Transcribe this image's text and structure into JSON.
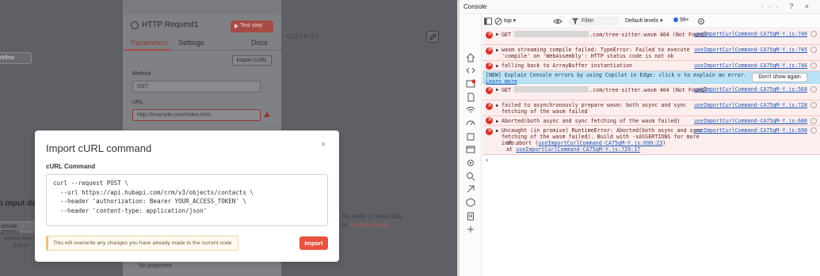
{
  "background": {
    "workflow_select": "rkflow",
    "no_input": "o input da",
    "execute_previous": "xecute previou",
    "hint_left": "earliest node t... data ye",
    "output_label": "OUTPUT",
    "hint_right_1": "his node to view data",
    "hint_right_2_prefix": "or ",
    "hint_right_2_link": "set mock data",
    "pencil_icon": "pencil-icon"
  },
  "node": {
    "title": "HTTP Request1",
    "test_step": "Test step",
    "tabs": [
      "Parameters",
      "Settings",
      "Docs"
    ],
    "import_curl": "Import cURL",
    "method_label": "Method",
    "method_value": "GET",
    "url_label": "URL",
    "url_placeholder": "http://example.com/index.html",
    "no_properties": "No properties"
  },
  "modal": {
    "title": "Import cURL command",
    "close_label": "×",
    "curl_label": "cURL Command",
    "curl_value": "curl --request POST \\\n  --url https://api.hubapi.com/crm/v3/objects/contacts \\\n  --header 'authorization: Bearer YOUR_ACCESS_TOKEN' \\\n  --header 'content-type: application/json'",
    "warning": "This will overwrite any changes you have already made to the current node",
    "import_button": "Import"
  },
  "devtools": {
    "title": "Console",
    "title_controls": "··· ? ×",
    "context": "top ▾",
    "filter": "Filter",
    "levels": "Default levels ▾",
    "badge": "99+",
    "messages": [
      {
        "type": "error",
        "pre": "GET ",
        "redacted": true,
        "post": ".com/tree-sitter.wasm 404 (Not Found)",
        "src": "useImportCurlCommand-CA75qM-Y.js:740"
      },
      {
        "type": "error",
        "pre": "wasm streaming compile failed: TypeError: Failed to execute 'compile' on 'WebAssembly': HTTP status code is not ok",
        "src": "useImportCurlCommand-CA75qM-Y.js:745"
      },
      {
        "type": "error",
        "pre": "falling back to ArrayBuffer instantiation",
        "src": "useImportCurlCommand-CA75qM-Y.js:746"
      },
      {
        "type": "error",
        "pre": "GET ",
        "redacted": true,
        "post": ".com/tree-sitter.wasm 404 (Not Found)",
        "src": "useImportCurlCommand-CA75qM-Y.js:568"
      },
      {
        "type": "error",
        "pre": "failed to asynchronously prepare wasm: both async and sync fetching of the wasm failed",
        "src": "useImportCurlCommand-CA75qM-Y.js:728"
      },
      {
        "type": "error",
        "pre": "Aborted(both async and sync fetching of the wasm failed)",
        "src": "useImportCurlCommand-CA75qM-Y.js:686"
      },
      {
        "type": "error",
        "pre": "Uncaught (in promise) RuntimeError: Aborted(both async and sync fetching of the wasm failed). Build with -sASSERTIONS for more info.",
        "src": "useImportCurlCommand-CA75qM-Y.js:690"
      }
    ],
    "trace_1_prefix": "at abort (",
    "trace_1_link": "useImportCurlCommand-CA75qM-Y.js:690:23",
    "trace_1_suffix": ")",
    "trace_2_prefix": "at ",
    "trace_2_link": "useImportCurlCommand-CA75qM-Y.js:729:17",
    "banner_text": "[NEW] Explain Console errors by using Copilot in Edge: click",
    "banner_text_2": "to explain an error.",
    "banner_learn_more": "Learn more",
    "dismiss": "Don't show again",
    "prompt": "›"
  }
}
